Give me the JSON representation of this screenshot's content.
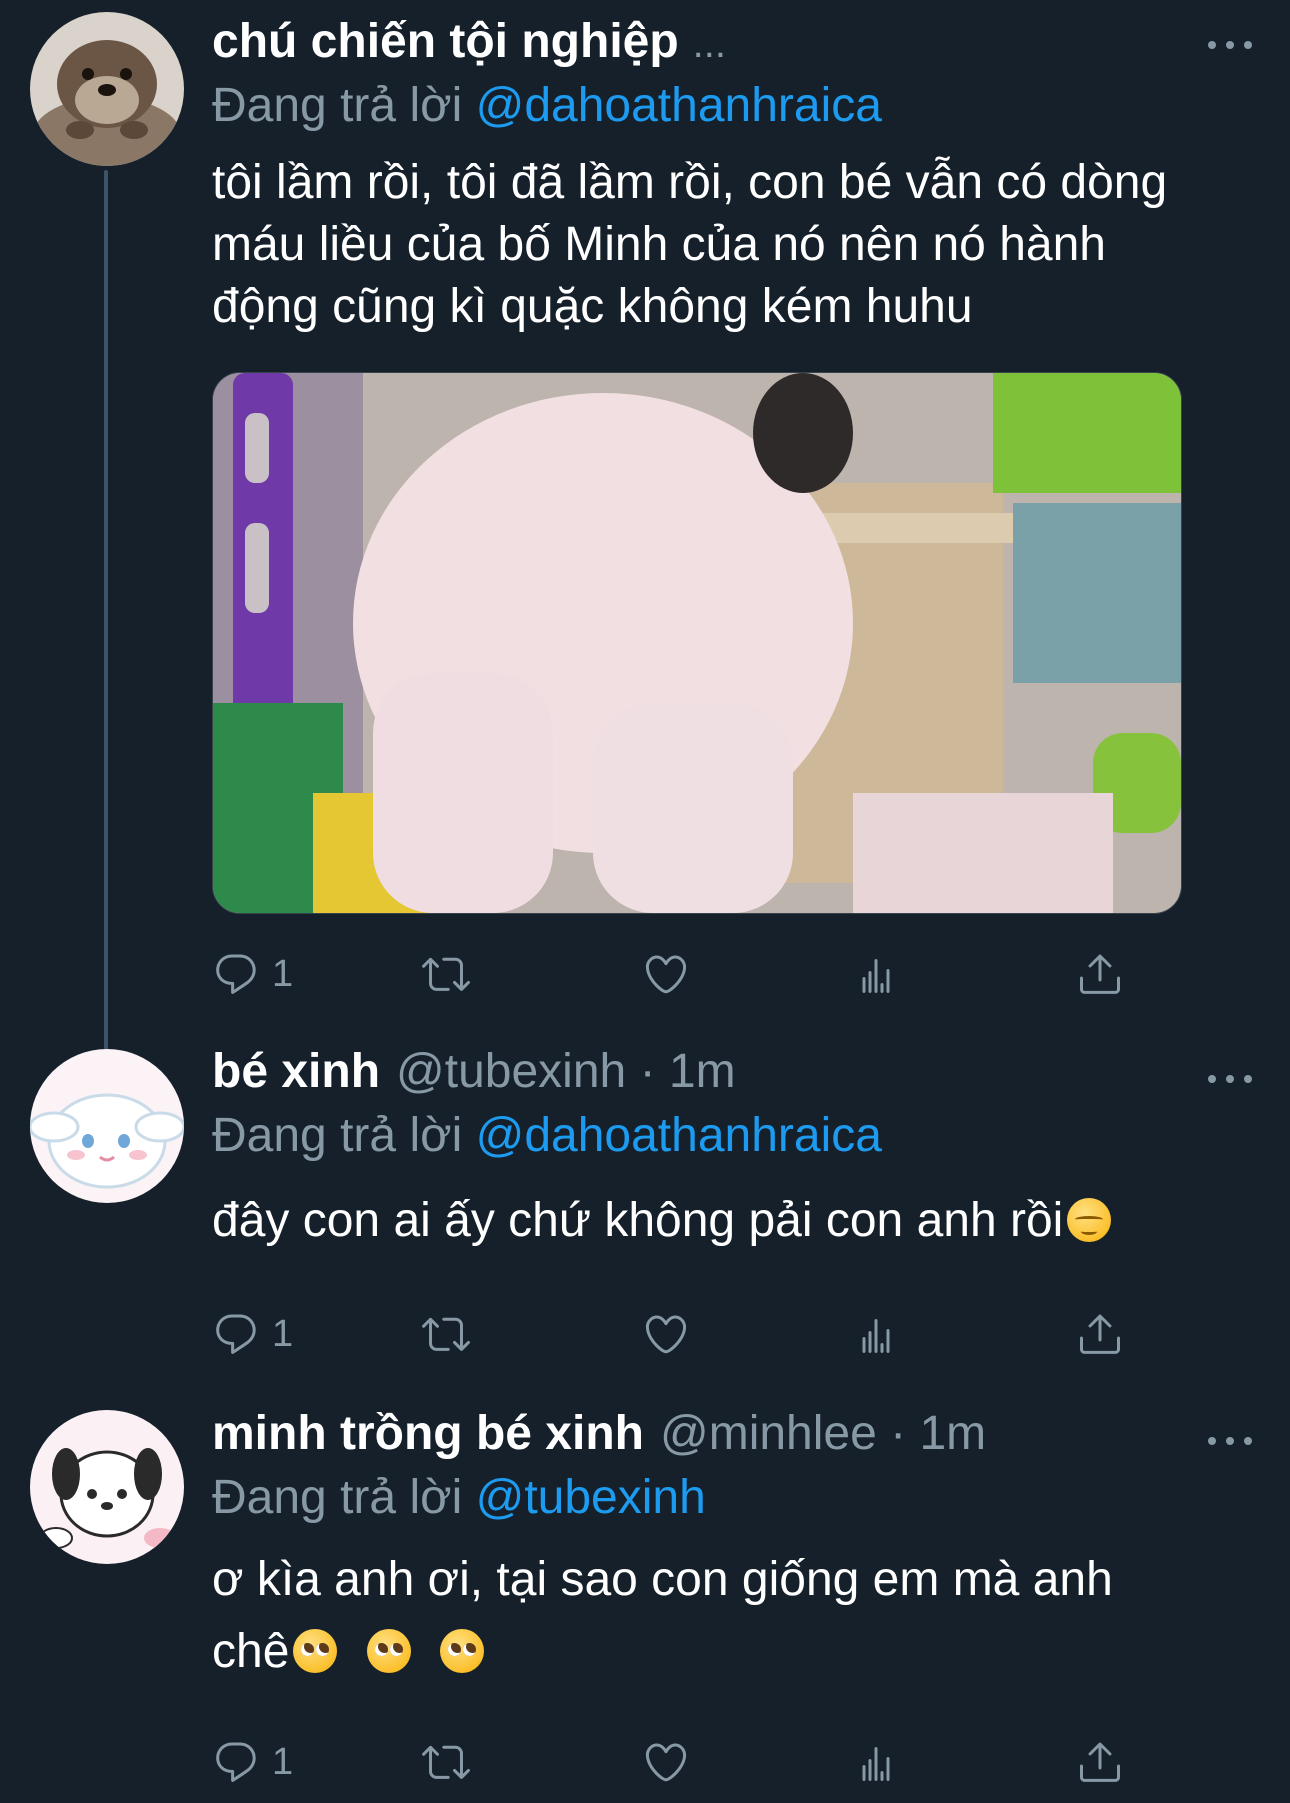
{
  "tweets": [
    {
      "name": "chú chiến tội nghiệp",
      "handle": "",
      "ellipsis": "...",
      "replying_prefix": "Đang trả lời",
      "replying_to": "@dahoathanhraica",
      "text": "tôi lầm rồi, tôi đã lầm rồi, con bé vẫn có dòng máu liều của bố Minh của nó nên nó hành động cũng kì quặc không kém huhu",
      "reply_count": "1",
      "avatar_icon": "otter-avatar-icon"
    },
    {
      "name": "bé xinh",
      "handle": "@tubexinh · 1m",
      "replying_prefix": "Đang trả lời",
      "replying_to": "@dahoathanhraica",
      "text": "đây con ai ấy chứ không pải con anh rồi",
      "reply_count": "1",
      "avatar_icon": "cinnamoroll-avatar-icon"
    },
    {
      "name": "minh trồng bé xinh",
      "handle": "@minhlee · 1m",
      "replying_prefix": "Đang trả lời",
      "replying_to": "@tubexinh",
      "text_line1": "ơ kìa anh ơi, tại sao con giống em mà anh",
      "text_line2": "chê",
      "reply_count": "1",
      "avatar_icon": "pochacco-avatar-icon"
    }
  ],
  "colors": {
    "background": "#15202b",
    "text": "#ffffff",
    "muted": "#8899a6",
    "accent": "#1d9bf0",
    "thread_line": "#3d5466"
  },
  "icons": [
    "reply-icon",
    "retweet-icon",
    "like-icon",
    "analytics-icon",
    "share-icon",
    "more-icon"
  ]
}
